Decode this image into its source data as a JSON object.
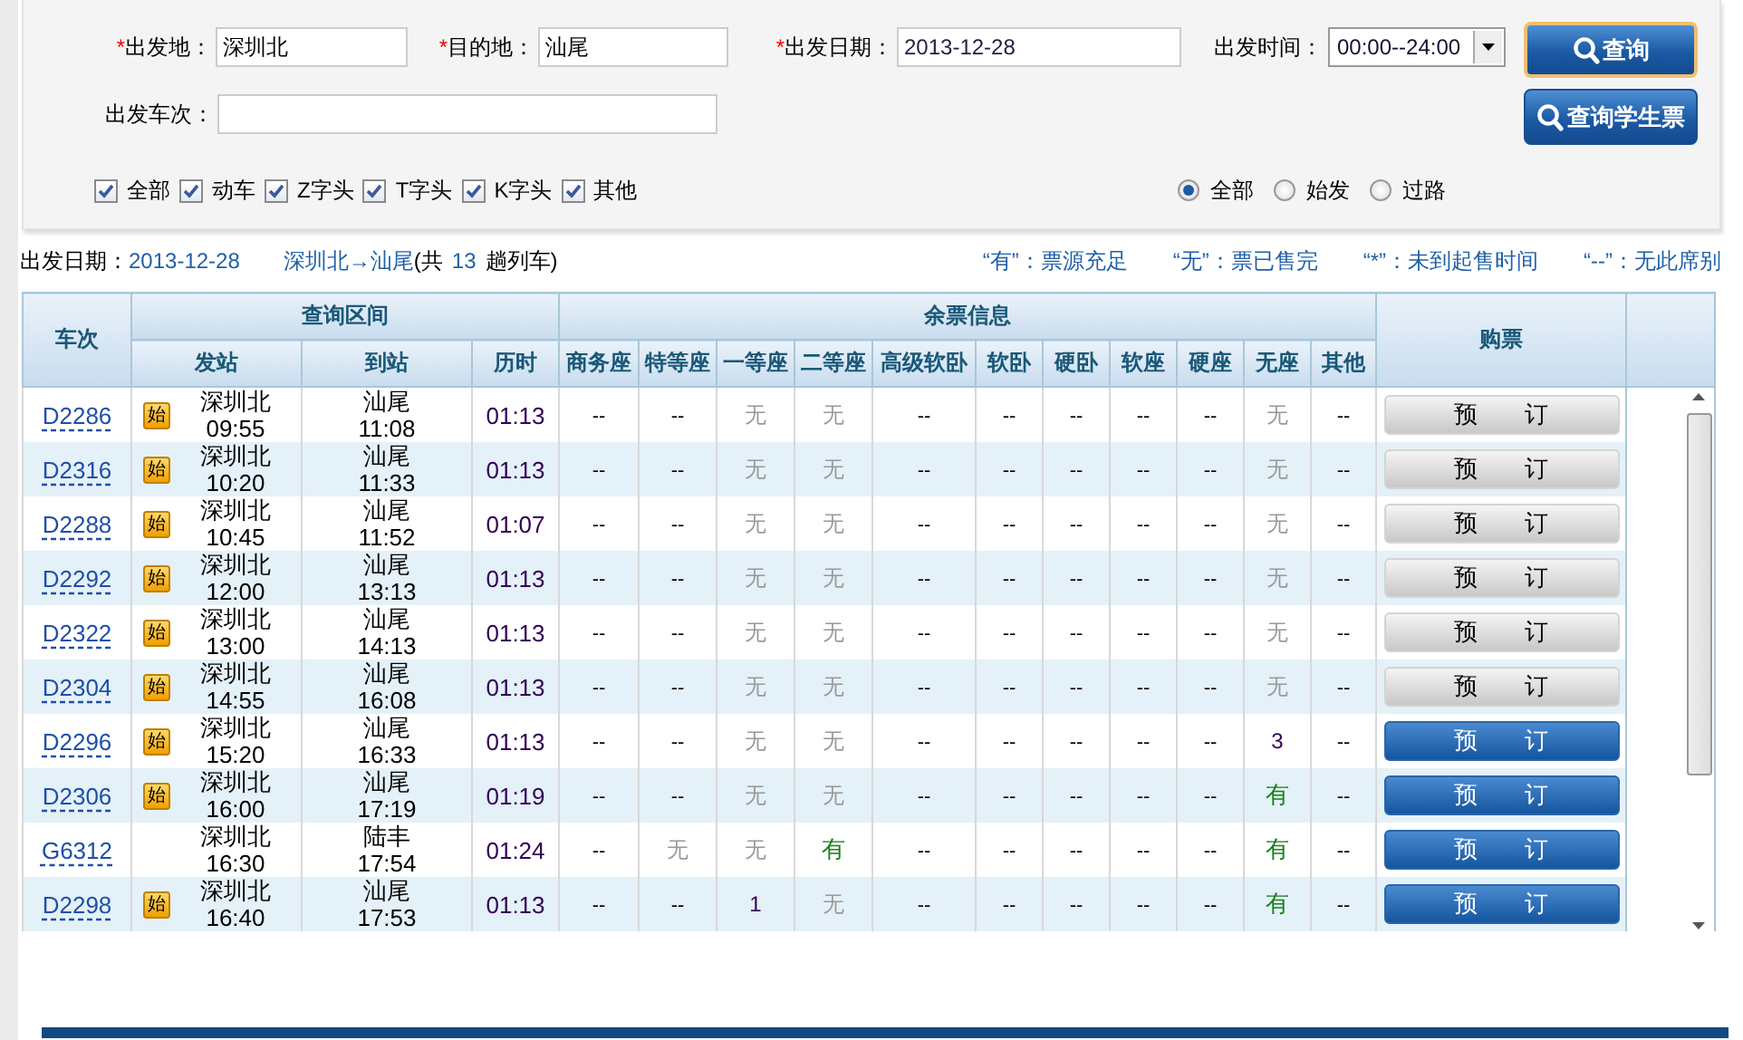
{
  "form": {
    "fields": [
      {
        "required_mark": "*",
        "label": "出发地：",
        "value": "深圳北"
      },
      {
        "required_mark": "*",
        "label": "目的地：",
        "value": "汕尾"
      },
      {
        "required_mark": "*",
        "label": "出发日期：",
        "value": "2013-12-28"
      }
    ],
    "time": {
      "label": "出发时间：",
      "value": "00:00--24:00"
    },
    "train_field": {
      "label": "出发车次："
    },
    "buttons": [
      {
        "label": "查询",
        "focused": true
      },
      {
        "label": "查询学生票",
        "focused": false
      }
    ],
    "train_types": [
      {
        "label": "全部",
        "checked": true
      },
      {
        "label": "动车",
        "checked": true
      },
      {
        "label": "Z字头",
        "checked": true
      },
      {
        "label": "T字头",
        "checked": true
      },
      {
        "label": "K字头",
        "checked": true
      },
      {
        "label": "其他",
        "checked": true
      }
    ],
    "station_filter": [
      {
        "label": "全部",
        "selected": true
      },
      {
        "label": "始发",
        "selected": false
      },
      {
        "label": "过路",
        "selected": false
      }
    ]
  },
  "summary": {
    "date_label": "出发日期：",
    "date": "2013-12-28",
    "route": "深圳北→汕尾",
    "count_prefix": "(共",
    "count": "13",
    "count_suffix": "趟列车)"
  },
  "legend": [
    "“有”：票源充足",
    "“无”：票已售完",
    "“*”：未到起售时间",
    "“--”：无此席别"
  ],
  "table": {
    "header": {
      "train": "车次",
      "interval": {
        "title": "查询区间",
        "columns": [
          "发站",
          "到站",
          "历时"
        ]
      },
      "seats": {
        "title": "余票信息",
        "columns": [
          "商务座",
          "特等座",
          "一等座",
          "二等座",
          "高级软卧",
          "软卧",
          "硬卧",
          "软座",
          "硬座",
          "无座",
          "其他"
        ]
      },
      "buy": "购票"
    },
    "rows": [
      {
        "train": "D2286",
        "badge": "始",
        "from": "深圳北",
        "dep": "09:55",
        "to": "汕尾",
        "arr": "11:08",
        "duration": "01:13",
        "seats": [
          {
            "text": "--",
            "kind": "na"
          },
          {
            "text": "--",
            "kind": "na"
          },
          {
            "text": "无",
            "kind": "none"
          },
          {
            "text": "无",
            "kind": "none"
          },
          {
            "text": "--",
            "kind": "na"
          },
          {
            "text": "--",
            "kind": "na"
          },
          {
            "text": "--",
            "kind": "na"
          },
          {
            "text": "--",
            "kind": "na"
          },
          {
            "text": "--",
            "kind": "na"
          },
          {
            "text": "无",
            "kind": "none"
          },
          {
            "text": "--",
            "kind": "na"
          }
        ],
        "button": "预　　订",
        "disabled": true
      },
      {
        "train": "D2316",
        "badge": "始",
        "from": "深圳北",
        "dep": "10:20",
        "to": "汕尾",
        "arr": "11:33",
        "duration": "01:13",
        "seats": [
          {
            "text": "--",
            "kind": "na"
          },
          {
            "text": "--",
            "kind": "na"
          },
          {
            "text": "无",
            "kind": "none"
          },
          {
            "text": "无",
            "kind": "none"
          },
          {
            "text": "--",
            "kind": "na"
          },
          {
            "text": "--",
            "kind": "na"
          },
          {
            "text": "--",
            "kind": "na"
          },
          {
            "text": "--",
            "kind": "na"
          },
          {
            "text": "--",
            "kind": "na"
          },
          {
            "text": "无",
            "kind": "none"
          },
          {
            "text": "--",
            "kind": "na"
          }
        ],
        "button": "预　　订",
        "disabled": true
      },
      {
        "train": "D2288",
        "badge": "始",
        "from": "深圳北",
        "dep": "10:45",
        "to": "汕尾",
        "arr": "11:52",
        "duration": "01:07",
        "seats": [
          {
            "text": "--",
            "kind": "na"
          },
          {
            "text": "--",
            "kind": "na"
          },
          {
            "text": "无",
            "kind": "none"
          },
          {
            "text": "无",
            "kind": "none"
          },
          {
            "text": "--",
            "kind": "na"
          },
          {
            "text": "--",
            "kind": "na"
          },
          {
            "text": "--",
            "kind": "na"
          },
          {
            "text": "--",
            "kind": "na"
          },
          {
            "text": "--",
            "kind": "na"
          },
          {
            "text": "无",
            "kind": "none"
          },
          {
            "text": "--",
            "kind": "na"
          }
        ],
        "button": "预　　订",
        "disabled": true
      },
      {
        "train": "D2292",
        "badge": "始",
        "from": "深圳北",
        "dep": "12:00",
        "to": "汕尾",
        "arr": "13:13",
        "duration": "01:13",
        "seats": [
          {
            "text": "--",
            "kind": "na"
          },
          {
            "text": "--",
            "kind": "na"
          },
          {
            "text": "无",
            "kind": "none"
          },
          {
            "text": "无",
            "kind": "none"
          },
          {
            "text": "--",
            "kind": "na"
          },
          {
            "text": "--",
            "kind": "na"
          },
          {
            "text": "--",
            "kind": "na"
          },
          {
            "text": "--",
            "kind": "na"
          },
          {
            "text": "--",
            "kind": "na"
          },
          {
            "text": "无",
            "kind": "none"
          },
          {
            "text": "--",
            "kind": "na"
          }
        ],
        "button": "预　　订",
        "disabled": true
      },
      {
        "train": "D2322",
        "badge": "始",
        "from": "深圳北",
        "dep": "13:00",
        "to": "汕尾",
        "arr": "14:13",
        "duration": "01:13",
        "seats": [
          {
            "text": "--",
            "kind": "na"
          },
          {
            "text": "--",
            "kind": "na"
          },
          {
            "text": "无",
            "kind": "none"
          },
          {
            "text": "无",
            "kind": "none"
          },
          {
            "text": "--",
            "kind": "na"
          },
          {
            "text": "--",
            "kind": "na"
          },
          {
            "text": "--",
            "kind": "na"
          },
          {
            "text": "--",
            "kind": "na"
          },
          {
            "text": "--",
            "kind": "na"
          },
          {
            "text": "无",
            "kind": "none"
          },
          {
            "text": "--",
            "kind": "na"
          }
        ],
        "button": "预　　订",
        "disabled": true
      },
      {
        "train": "D2304",
        "badge": "始",
        "from": "深圳北",
        "dep": "14:55",
        "to": "汕尾",
        "arr": "16:08",
        "duration": "01:13",
        "seats": [
          {
            "text": "--",
            "kind": "na"
          },
          {
            "text": "--",
            "kind": "na"
          },
          {
            "text": "无",
            "kind": "none"
          },
          {
            "text": "无",
            "kind": "none"
          },
          {
            "text": "--",
            "kind": "na"
          },
          {
            "text": "--",
            "kind": "na"
          },
          {
            "text": "--",
            "kind": "na"
          },
          {
            "text": "--",
            "kind": "na"
          },
          {
            "text": "--",
            "kind": "na"
          },
          {
            "text": "无",
            "kind": "none"
          },
          {
            "text": "--",
            "kind": "na"
          }
        ],
        "button": "预　　订",
        "disabled": true
      },
      {
        "train": "D2296",
        "badge": "始",
        "from": "深圳北",
        "dep": "15:20",
        "to": "汕尾",
        "arr": "16:33",
        "duration": "01:13",
        "seats": [
          {
            "text": "--",
            "kind": "na"
          },
          {
            "text": "--",
            "kind": "na"
          },
          {
            "text": "无",
            "kind": "none"
          },
          {
            "text": "无",
            "kind": "none"
          },
          {
            "text": "--",
            "kind": "na"
          },
          {
            "text": "--",
            "kind": "na"
          },
          {
            "text": "--",
            "kind": "na"
          },
          {
            "text": "--",
            "kind": "na"
          },
          {
            "text": "--",
            "kind": "na"
          },
          {
            "text": "3",
            "kind": "count"
          },
          {
            "text": "--",
            "kind": "na"
          }
        ],
        "button": "预　　订",
        "disabled": false
      },
      {
        "train": "D2306",
        "badge": "始",
        "from": "深圳北",
        "dep": "16:00",
        "to": "汕尾",
        "arr": "17:19",
        "duration": "01:19",
        "seats": [
          {
            "text": "--",
            "kind": "na"
          },
          {
            "text": "--",
            "kind": "na"
          },
          {
            "text": "无",
            "kind": "none"
          },
          {
            "text": "无",
            "kind": "none"
          },
          {
            "text": "--",
            "kind": "na"
          },
          {
            "text": "--",
            "kind": "na"
          },
          {
            "text": "--",
            "kind": "na"
          },
          {
            "text": "--",
            "kind": "na"
          },
          {
            "text": "--",
            "kind": "na"
          },
          {
            "text": "有",
            "kind": "available"
          },
          {
            "text": "--",
            "kind": "na"
          }
        ],
        "button": "预　　订",
        "disabled": false
      },
      {
        "train": "G6312",
        "from": "深圳北",
        "dep": "16:30",
        "to": "陆丰",
        "arr": "17:54",
        "duration": "01:24",
        "seats": [
          {
            "text": "--",
            "kind": "na"
          },
          {
            "text": "无",
            "kind": "none"
          },
          {
            "text": "无",
            "kind": "none"
          },
          {
            "text": "有",
            "kind": "available"
          },
          {
            "text": "--",
            "kind": "na"
          },
          {
            "text": "--",
            "kind": "na"
          },
          {
            "text": "--",
            "kind": "na"
          },
          {
            "text": "--",
            "kind": "na"
          },
          {
            "text": "--",
            "kind": "na"
          },
          {
            "text": "有",
            "kind": "available"
          },
          {
            "text": "--",
            "kind": "na"
          }
        ],
        "button": "预　　订",
        "disabled": false
      },
      {
        "train": "D2298",
        "badge": "始",
        "from": "深圳北",
        "dep": "16:40",
        "to": "汕尾",
        "arr": "17:53",
        "duration": "01:13",
        "seats": [
          {
            "text": "--",
            "kind": "na"
          },
          {
            "text": "--",
            "kind": "na"
          },
          {
            "text": "1",
            "kind": "count"
          },
          {
            "text": "无",
            "kind": "none"
          },
          {
            "text": "--",
            "kind": "na"
          },
          {
            "text": "--",
            "kind": "na"
          },
          {
            "text": "--",
            "kind": "na"
          },
          {
            "text": "--",
            "kind": "na"
          },
          {
            "text": "--",
            "kind": "na"
          },
          {
            "text": "有",
            "kind": "available"
          },
          {
            "text": "--",
            "kind": "na"
          }
        ],
        "button": "预　　订",
        "disabled": false
      }
    ]
  }
}
